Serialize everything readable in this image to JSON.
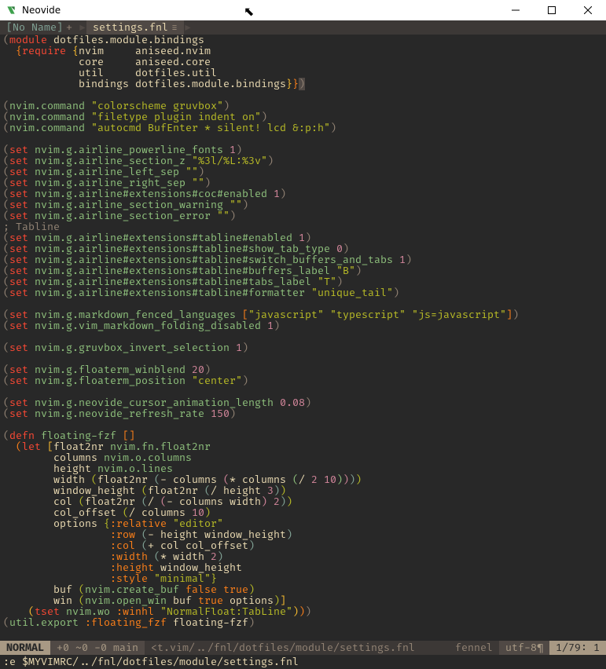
{
  "titlebar": {
    "title": "Neovide"
  },
  "tabs": {
    "inactive": "[No Name]",
    "inactive_mod": "+",
    "active": "settings.fnl",
    "active_mod": "≡"
  },
  "status": {
    "mode": " NORMAL ",
    "git": " +0 ~0 -0  main ",
    "file": "<t.vim/../fnl/dotfiles/module/settings.fnl",
    "filetype": "fennel",
    "encoding": "utf-8",
    "position": "1/79:   1"
  },
  "cmdline": ":e $MYVIMRC/../fnl/dotfiles/module/settings.fnl",
  "syn": {
    "module": "module",
    "require": "require",
    "nvim": "nvim",
    "aniseed_nvim": "aniseed.nvim",
    "core": "core",
    "aniseed_core": "aniseed.core",
    "util": "util",
    "dotfiles_util": "dotfiles.util",
    "bindings": "bindings",
    "dotfiles_module_bindings": "dotfiles.module.bindings",
    "dotfiles_module_bindings_ns": "dotfiles.module.bindings",
    "nvim_command": "nvim.command",
    "colorscheme": "\"colorscheme gruvbox\"",
    "filetype": "\"filetype plugin indent on\"",
    "autocmd": "\"autocmd BufEnter * silent! lcd &:p:h\"",
    "set": "set",
    "airline_powerline_fonts": "nvim.g.airline_powerline_fonts",
    "one": "1",
    "zero": "0",
    "two": "2",
    "three": "3",
    "ten": "10",
    "twenty": "20",
    "onefifty": "150",
    "eight": "0.08",
    "airline_section_z": "nvim.g.airline_section_z",
    "section_z_val": "\"%3l/%L:%3v\"",
    "airline_left_sep": "nvim.g.airline_left_sep",
    "left_sep_val": "\"\"",
    "airline_right_sep": "nvim.g.airline_right_sep",
    "right_sep_val": "\"\"",
    "coc_enabled": "nvim.g.airline#extensions#coc#enabled",
    "section_warning": "nvim.g.airline_section_warning",
    "empty": "\"\"",
    "section_error": "nvim.g.airline_section_error",
    "tabline_comment": "; Tabline",
    "tabline_enabled": "nvim.g.airline#extensions#tabline#enabled",
    "show_tab_type": "nvim.g.airline#extensions#tabline#show_tab_type",
    "switch_buffers": "nvim.g.airline#extensions#tabline#switch_buffers_and_tabs",
    "buffers_label": "nvim.g.airline#extensions#tabline#buffers_label",
    "B": "\"B\"",
    "tabs_label": "nvim.g.airline#extensions#tabline#tabs_label",
    "T": "\"T\"",
    "formatter": "nvim.g.airline#extensions#tabline#formatter",
    "unique_tail": "\"unique_tail\"",
    "md_fenced": "nvim.g.markdown_fenced_languages",
    "js": "\"javascript\"",
    "ts": "\"typescript\"",
    "jseq": "\"js=javascript\"",
    "md_fold": "nvim.g.vim_markdown_folding_disabled",
    "invert": "nvim.g.gruvbox_invert_selection",
    "winblend": "nvim.g.floaterm_winblend",
    "position": "nvim.g.floaterm_position",
    "center": "\"center\"",
    "anim": "nvim.g.neovide_cursor_animation_length",
    "refresh": "nvim.g.neovide_refresh_rate",
    "defn": "defn",
    "floating_fzf": "floating-fzf",
    "let": "let",
    "float2nr": "float2nr",
    "fn_float2nr": "nvim.fn.float2nr",
    "columns": "columns",
    "nvim_columns": "nvim.o.columns",
    "height": "height",
    "nvim_lines": "nvim.o.lines",
    "width": "width",
    "window_height": "window_height",
    "col": "col",
    "col_offset": "col_offset",
    "options": "options",
    "buf": "buf",
    "win": "win",
    "relative": ":relative",
    "editor": "\"editor\"",
    "row": ":row",
    "colk": ":col",
    "widthk": ":width",
    "heightk": ":height",
    "style": ":style",
    "minimal": "\"minimal\"",
    "create_buf": "nvim.create_buf",
    "false": "false",
    "true": "true",
    "open_win": "nvim.open_win",
    "tset": "tset",
    "nvim_wo": "nvim.wo",
    "winhl": ":winhl",
    "normalfloat": "\"NormalFloat:TabLine\"",
    "util_export": "util.export",
    "floating_fzf_kw": ":floating_fzf"
  }
}
